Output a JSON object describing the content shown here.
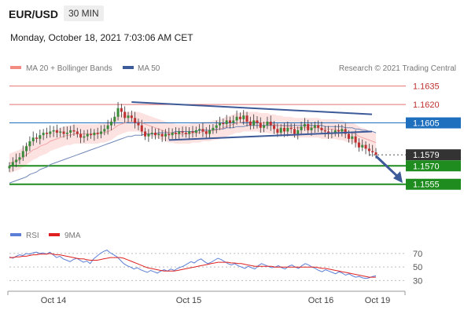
{
  "header": {
    "pair": "EUR/USD",
    "interval": "30 MIN",
    "timestamp": "Monday, October 18, 2021 7:03:06 AM CET"
  },
  "legend": {
    "items": [
      {
        "label": "MA 20 + Bollinger Bands",
        "color": "#f28b82"
      },
      {
        "label": "MA 50",
        "color": "#3d5a99"
      }
    ],
    "credit": "Research © 2021 Trading Central"
  },
  "rsi_legend": {
    "items": [
      {
        "label": "RSI",
        "color": "#5b7fd6"
      },
      {
        "label": "9MA",
        "color": "#e02020"
      }
    ]
  },
  "colors": {
    "bull": "#3a8a3a",
    "bear": "#c03030",
    "support": "#1e8c1e",
    "pivot": "#1f6fbf",
    "resistance": "#e57373",
    "trendline": "#3d5a99",
    "band": "#fde2e2"
  },
  "chart_data": [
    {
      "type": "candlestick",
      "title": "",
      "ylim": [
        1.1535,
        1.1645
      ],
      "x_labels": [
        "Oct 14",
        "Oct 15",
        "Oct 16",
        "Oct 19"
      ],
      "levels": [
        {
          "value": 1.1635,
          "label": "1.1635",
          "kind": "resistance"
        },
        {
          "value": 1.162,
          "label": "1.1620",
          "kind": "resistance"
        },
        {
          "value": 1.1605,
          "label": "1.1605",
          "kind": "pivot"
        },
        {
          "value": 1.1579,
          "label": "1.1579",
          "kind": "current"
        },
        {
          "value": 1.157,
          "label": "1.1570",
          "kind": "support"
        },
        {
          "value": 1.1555,
          "label": "1.1555",
          "kind": "support"
        }
      ],
      "close": [
        1.157,
        1.1573,
        1.1575,
        1.1577,
        1.1582,
        1.1586,
        1.159,
        1.1593,
        1.1592,
        1.1595,
        1.1597,
        1.1596,
        1.1598,
        1.1599,
        1.1597,
        1.1598,
        1.1596,
        1.1597,
        1.1599,
        1.1598,
        1.1596,
        1.1593,
        1.1594,
        1.1596,
        1.1595,
        1.1597,
        1.1596,
        1.1598,
        1.16,
        1.1603,
        1.1606,
        1.161,
        1.1617,
        1.1614,
        1.1609,
        1.1611,
        1.1609,
        1.1605,
        1.1603,
        1.1598,
        1.1594,
        1.1596,
        1.1597,
        1.1595,
        1.1596,
        1.1594,
        1.1596,
        1.1595,
        1.1597,
        1.1596,
        1.1598,
        1.1597,
        1.1596,
        1.1598,
        1.1597,
        1.1599,
        1.16,
        1.1598,
        1.1596,
        1.1599,
        1.1601,
        1.1603,
        1.1605,
        1.1604,
        1.1607,
        1.1605,
        1.1607,
        1.161,
        1.1608,
        1.1611,
        1.1606,
        1.1603,
        1.1607,
        1.1605,
        1.1601,
        1.1603,
        1.1606,
        1.1603,
        1.16,
        1.1597,
        1.1601,
        1.1598,
        1.1601,
        1.16,
        1.1596,
        1.1599,
        1.1602,
        1.1604,
        1.1599,
        1.1601,
        1.1603,
        1.1601,
        1.1599,
        1.1598,
        1.1596,
        1.1597,
        1.1599,
        1.1598,
        1.16,
        1.1596,
        1.1592,
        1.1594,
        1.1589,
        1.1585,
        1.1587,
        1.1584,
        1.1582,
        1.1581,
        1.1579
      ],
      "ma20": [
        1.1572,
        1.1573,
        1.1574,
        1.1575,
        1.1577,
        1.1579,
        1.1581,
        1.1583,
        1.1584,
        1.1586,
        1.1587,
        1.1588,
        1.159,
        1.1591,
        1.1592,
        1.1593,
        1.1594,
        1.1595,
        1.1595,
        1.1596,
        1.1596,
        1.1596,
        1.1596,
        1.1596,
        1.1596,
        1.1596,
        1.1596,
        1.1597,
        1.1597,
        1.1598,
        1.1599,
        1.1601,
        1.1603,
        1.1604,
        1.1605,
        1.1606,
        1.1606,
        1.1606,
        1.1606,
        1.1605,
        1.1604,
        1.1603,
        1.1602,
        1.1601,
        1.16,
        1.1599,
        1.1598,
        1.1597,
        1.1597,
        1.1596,
        1.1596,
        1.1596,
        1.1596,
        1.1596,
        1.1597,
        1.1597,
        1.1597,
        1.1598,
        1.1598,
        1.1598,
        1.1599,
        1.1599,
        1.16,
        1.1601,
        1.1602,
        1.1603,
        1.1604,
        1.1605,
        1.1605,
        1.1606,
        1.1606,
        1.1606,
        1.1606,
        1.1606,
        1.1605,
        1.1605,
        1.1605,
        1.1604,
        1.1604,
        1.1603,
        1.1603,
        1.1602,
        1.1602,
        1.1602,
        1.1601,
        1.1601,
        1.1601,
        1.1601,
        1.1601,
        1.1601,
        1.1601,
        1.1601,
        1.16,
        1.16,
        1.16,
        1.16,
        1.16,
        1.1599,
        1.1599,
        1.1598,
        1.1597,
        1.1597,
        1.1596,
        1.1594,
        1.1593,
        1.1592,
        1.1591,
        1.159,
        1.1589
      ],
      "ma50": [
        1.1556,
        1.1557,
        1.1558,
        1.1559,
        1.156,
        1.1561,
        1.1563,
        1.1564,
        1.1565,
        1.1567,
        1.1568,
        1.1569,
        1.1571,
        1.1572,
        1.1573,
        1.1574,
        1.1575,
        1.1576,
        1.1577,
        1.1578,
        1.1579,
        1.158,
        1.1581,
        1.1582,
        1.1583,
        1.1584,
        1.1585,
        1.1586,
        1.1587,
        1.1588,
        1.1589,
        1.159,
        1.1591,
        1.1592,
        1.1593,
        1.1594,
        1.1594,
        1.1595,
        1.1595,
        1.1595,
        1.1596,
        1.1596,
        1.1596,
        1.1596,
        1.1597,
        1.1597,
        1.1597,
        1.1597,
        1.1597,
        1.1598,
        1.1598,
        1.1598,
        1.1598,
        1.1598,
        1.1598,
        1.1598,
        1.1599,
        1.1599,
        1.1599,
        1.1599,
        1.1599,
        1.16,
        1.16,
        1.16,
        1.1601,
        1.1601,
        1.1601,
        1.1602,
        1.1602,
        1.1602,
        1.1603,
        1.1603,
        1.1603,
        1.1603,
        1.1603,
        1.1603,
        1.1603,
        1.1603,
        1.1603,
        1.1603,
        1.1603,
        1.1603,
        1.1603,
        1.1603,
        1.1603,
        1.1603,
        1.1603,
        1.1603,
        1.1603,
        1.1603,
        1.1603,
        1.1603,
        1.1603,
        1.1602,
        1.1602,
        1.1602,
        1.1602,
        1.1602,
        1.1602,
        1.1601,
        1.1601,
        1.1601,
        1.16,
        1.16,
        1.1599,
        1.1599,
        1.1598,
        1.1598,
        1.1597
      ],
      "trendlines": [
        {
          "from": [
            36,
            1.1622
          ],
          "to": [
            108,
            1.1612
          ]
        },
        {
          "from": [
            47,
            1.1591
          ],
          "to": [
            108,
            1.1598
          ]
        }
      ],
      "forecast_arrow": {
        "from": [
          108,
          1.1578
        ],
        "to": [
          121,
          1.1556
        ]
      }
    },
    {
      "type": "line",
      "title": "",
      "ylim": [
        20,
        85
      ],
      "y_ticks": [
        30,
        50,
        70
      ],
      "series": [
        {
          "name": "RSI",
          "values": [
            65,
            63,
            66,
            68,
            67,
            70,
            69,
            71,
            72,
            70,
            71,
            69,
            72,
            68,
            64,
            66,
            62,
            60,
            58,
            61,
            63,
            60,
            57,
            59,
            55,
            62,
            66,
            70,
            73,
            75,
            71,
            68,
            65,
            60,
            55,
            52,
            50,
            47,
            49,
            46,
            44,
            42,
            45,
            43,
            41,
            44,
            46,
            44,
            47,
            45,
            48,
            50,
            52,
            55,
            58,
            56,
            60,
            62,
            58,
            55,
            57,
            60,
            63,
            61,
            58,
            55,
            53,
            55,
            52,
            50,
            48,
            51,
            49,
            47,
            52,
            55,
            53,
            51,
            49,
            50,
            52,
            49,
            47,
            51,
            53,
            50,
            48,
            52,
            55,
            53,
            50,
            48,
            45,
            43,
            46,
            44,
            42,
            40,
            43,
            41,
            38,
            40,
            37,
            35,
            36,
            34,
            33,
            34,
            36,
            37
          ]
        },
        {
          "name": "9MA",
          "values": [
            64,
            64,
            65,
            65,
            66,
            66,
            67,
            68,
            68,
            69,
            69,
            69,
            70,
            69,
            68,
            68,
            67,
            66,
            65,
            64,
            63,
            62,
            62,
            61,
            60,
            60,
            60,
            61,
            62,
            63,
            64,
            64,
            64,
            64,
            63,
            61,
            59,
            57,
            55,
            53,
            51,
            49,
            48,
            47,
            46,
            45,
            44,
            44,
            44,
            44,
            45,
            46,
            47,
            48,
            49,
            50,
            51,
            52,
            53,
            54,
            55,
            56,
            57,
            57,
            57,
            57,
            56,
            56,
            55,
            55,
            54,
            53,
            52,
            51,
            51,
            51,
            51,
            51,
            51,
            50,
            50,
            50,
            50,
            50,
            50,
            50,
            50,
            50,
            50,
            50,
            50,
            50,
            49,
            48,
            48,
            47,
            46,
            45,
            44,
            43,
            42,
            41,
            40,
            39,
            38,
            37,
            36,
            35,
            35,
            35
          ]
        }
      ]
    }
  ]
}
